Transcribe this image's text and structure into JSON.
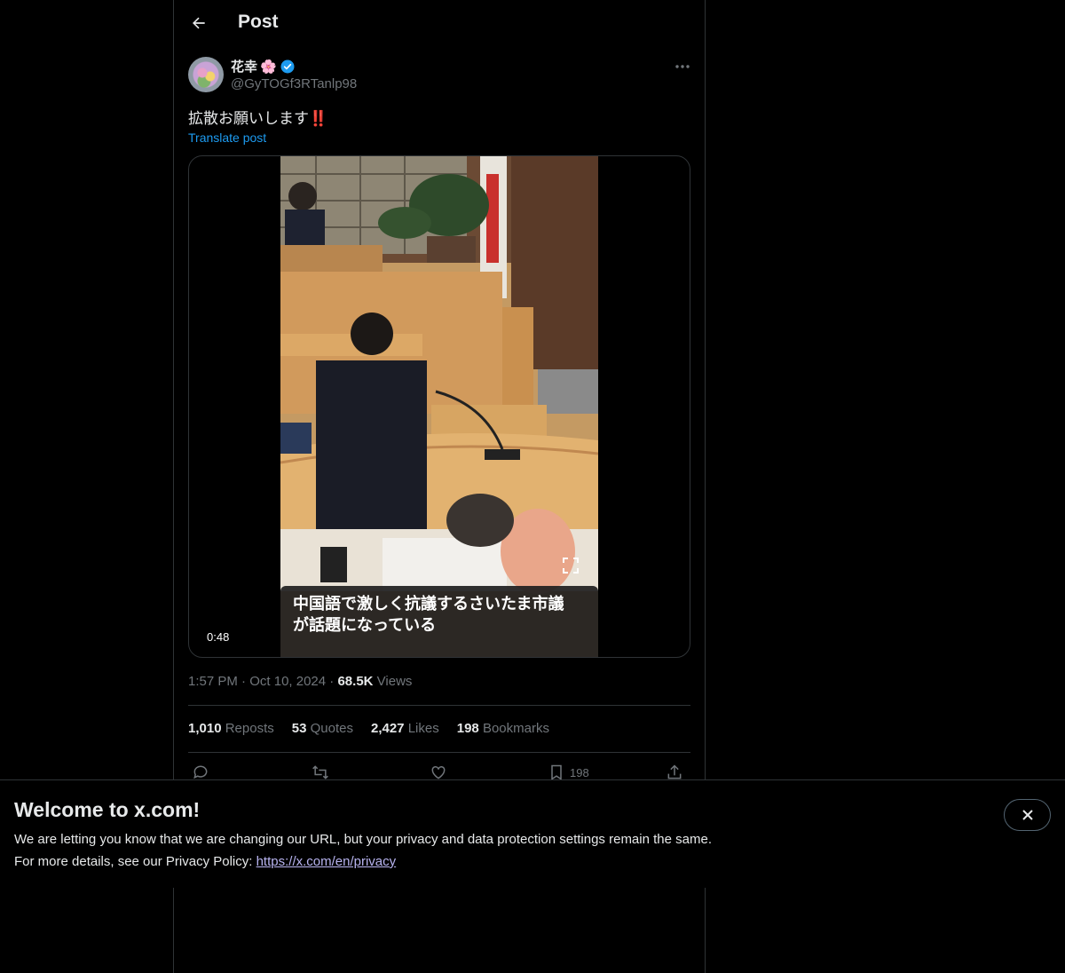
{
  "header": {
    "title": "Post"
  },
  "author": {
    "display_name": "花幸",
    "name_emoji": "🌸",
    "handle": "@GyTOGf3RTanlp98",
    "verified": true
  },
  "post": {
    "text": "拡散お願いします‼️",
    "translate_label": "Translate post",
    "video": {
      "duration": "0:48",
      "caption_line1": "中国語で激しく抗議するさいたま市議",
      "caption_line2": "が話題になっている"
    },
    "time": "1:57 PM",
    "date": "Oct 10, 2024",
    "views_count": "68.5K",
    "views_label": "Views",
    "sep": "·"
  },
  "stats": {
    "reposts_count": "1,010",
    "reposts_label": "Reposts",
    "quotes_count": "53",
    "quotes_label": "Quotes",
    "likes_count": "2,427",
    "likes_label": "Likes",
    "bookmarks_count": "198",
    "bookmarks_label": "Bookmarks"
  },
  "actions": {
    "bookmark_count": "198"
  },
  "banner": {
    "title": "Welcome to x.com!",
    "line1": "We are letting you know that we are changing our URL, but your privacy and data protection settings remain the same.",
    "line2_prefix": "For more details, see our Privacy Policy: ",
    "link_text": "https://x.com/en/privacy"
  },
  "colors": {
    "accent": "#1d9bf0",
    "muted": "#71767b",
    "background": "#000000",
    "border": "#2f3336"
  }
}
